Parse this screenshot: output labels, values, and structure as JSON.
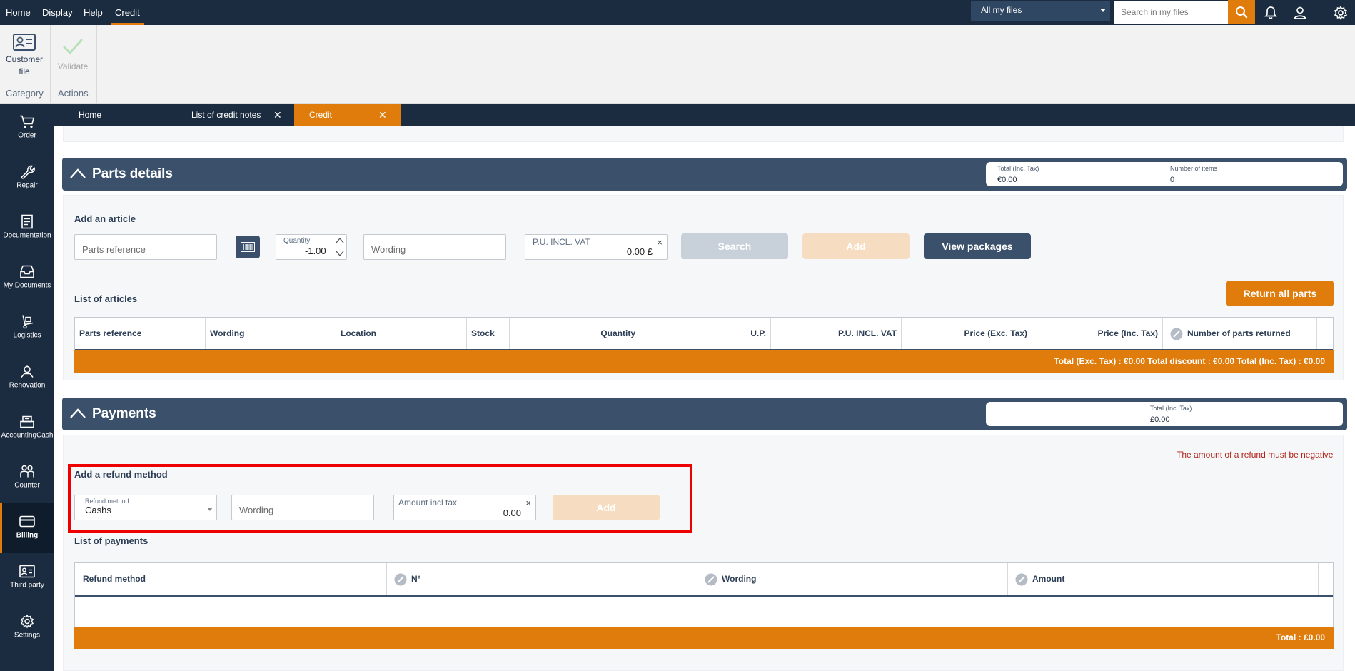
{
  "topbar": {
    "menu": [
      "Home",
      "Display",
      "Help",
      "Credit"
    ],
    "active_menu": "Credit",
    "scope_select": "All my files",
    "search_placeholder": "Search in my files"
  },
  "ribbon": {
    "customer_file_label_1": "Customer",
    "customer_file_label_2": "file",
    "validate_label": "Validate",
    "group_category": "Category",
    "group_actions": "Actions"
  },
  "tabs": [
    {
      "label": "Home"
    },
    {
      "label": "List of credit notes",
      "close": "✕"
    },
    {
      "label": "Credit",
      "close": "✕",
      "active": true
    }
  ],
  "sidebar": {
    "items": [
      {
        "label": "Order",
        "icon": "cart-icon"
      },
      {
        "label": "Repair",
        "icon": "wrench-icon"
      },
      {
        "label": "Documentation",
        "icon": "document-icon"
      },
      {
        "label": "My Documents",
        "icon": "inbox-icon"
      },
      {
        "label": "Logistics",
        "icon": "hand-truck-icon"
      },
      {
        "label": "Renovation",
        "icon": "spray-icon"
      },
      {
        "label": "AccountingCash",
        "icon": "cash-register-icon"
      },
      {
        "label": "Counter",
        "icon": "people-icon"
      },
      {
        "label": "Billing",
        "icon": "card-icon",
        "active": true
      },
      {
        "label": "Third party",
        "icon": "id-card-icon"
      },
      {
        "label": "Settings",
        "icon": "gear-icon"
      }
    ]
  },
  "parts_details": {
    "title": "Parts details",
    "summary": {
      "total_label": "Total (Inc. Tax)",
      "total_value": "€0.00",
      "items_label": "Number of items",
      "items_value": "0"
    },
    "add_article": {
      "heading": "Add an article",
      "parts_reference_placeholder": "Parts reference",
      "quantity_label": "Quantity",
      "quantity_value": "-1.00",
      "wording_placeholder": "Wording",
      "pu_label": "P.U. INCL. VAT",
      "pu_value": "0.00 £",
      "search_button": "Search",
      "add_button": "Add",
      "view_packages_button": "View packages"
    },
    "list": {
      "heading": "List of articles",
      "return_all_button": "Return all parts",
      "columns": [
        "Parts reference",
        "Wording",
        "Location",
        "Stock",
        "Quantity",
        "U.P.",
        "P.U. INCL. VAT",
        "Price (Exc. Tax)",
        "Price (Inc. Tax)",
        "Number of parts returned"
      ],
      "totals": "Total (Exc. Tax) : €0.00    Total discount : €0.00    Total (Inc. Tax) : €0.00"
    }
  },
  "payments": {
    "title": "Payments",
    "summary": {
      "total_label": "Total (Inc. Tax)",
      "total_value": "£0.00"
    },
    "error": "The amount of a refund must be negative",
    "add_refund": {
      "heading": "Add a refund method",
      "method_label": "Refund method",
      "method_value": "Cashs",
      "wording_placeholder": "Wording",
      "amount_label": "Amount incl tax",
      "amount_value": "0.00",
      "add_button": "Add"
    },
    "list": {
      "heading": "List of payments",
      "columns": [
        "Refund method",
        "N°",
        "Wording",
        "Amount"
      ],
      "total": "Total : £0.00"
    }
  },
  "colors": {
    "accent": "#e07c0c",
    "navy": "#1b2b40",
    "header": "#3a506b",
    "error_box": "#ee0000"
  }
}
